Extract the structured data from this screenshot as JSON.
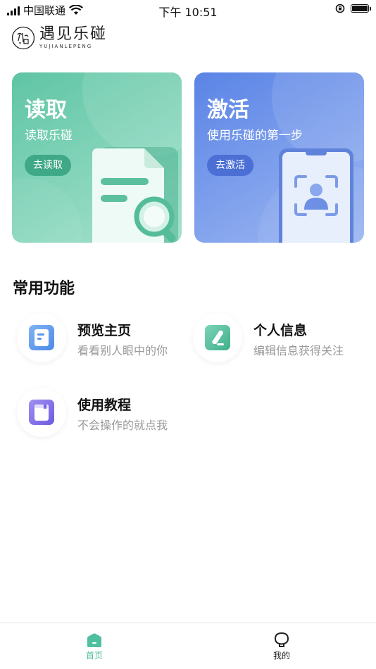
{
  "status_bar": {
    "carrier": "中国联通",
    "time": "下午 10:51"
  },
  "brand": {
    "name": "遇见乐碰",
    "subtitle": "YUJIANLEPENG"
  },
  "cards": {
    "read": {
      "title": "读取",
      "subtitle": "读取乐碰",
      "button": "去读取"
    },
    "activate": {
      "title": "激活",
      "subtitle": "使用乐碰的第一步",
      "button": "去激活"
    }
  },
  "common_functions": {
    "title": "常用功能",
    "items": [
      {
        "name": "预览主页",
        "desc": "看看别人眼中的你"
      },
      {
        "name": "个人信息",
        "desc": "编辑信息获得关注"
      },
      {
        "name": "使用教程",
        "desc": "不会操作的就点我"
      }
    ]
  },
  "tabbar": {
    "home": "首页",
    "mine": "我的"
  },
  "colors": {
    "accent": "#4fbfa0",
    "read_card": "#5fc5a4",
    "activate_card": "#5a84e6",
    "desc_text": "#999999"
  }
}
